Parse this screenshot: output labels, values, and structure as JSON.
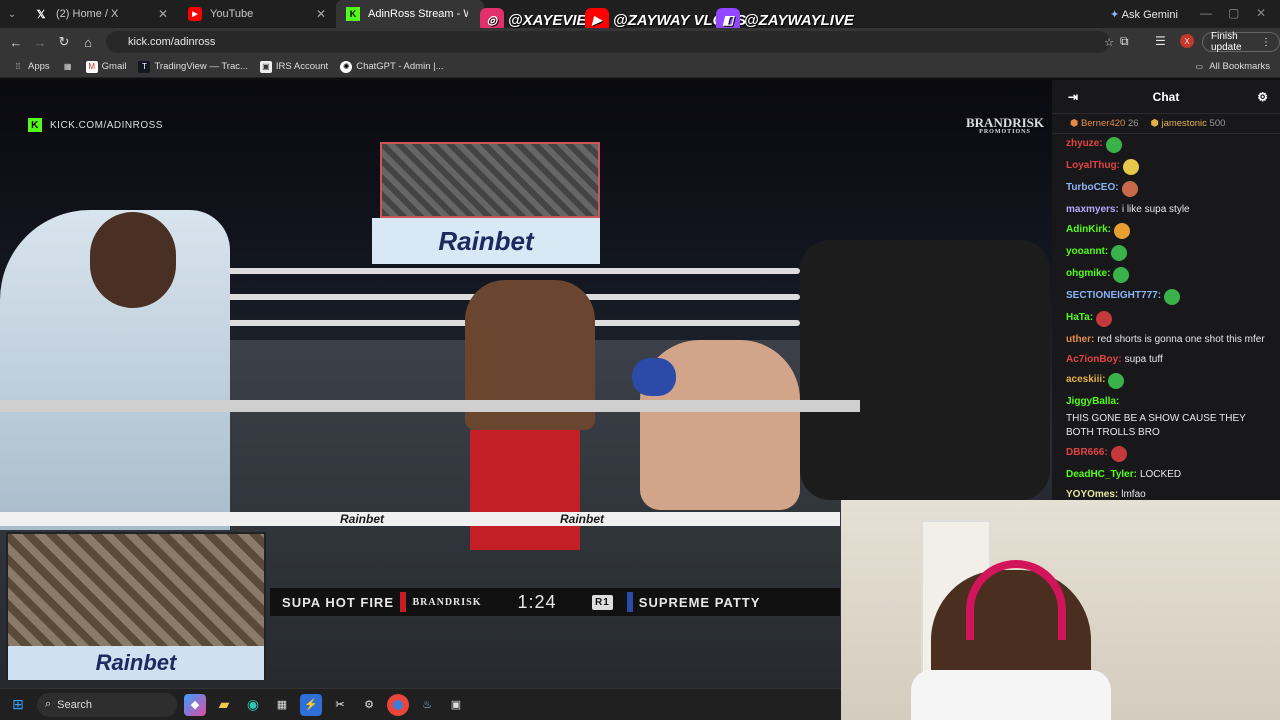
{
  "browser": {
    "tabs": [
      {
        "label": "(2) Home / X",
        "icon": "x-logo-icon"
      },
      {
        "label": "YouTube",
        "icon": "youtube-icon"
      },
      {
        "label": "AdinRoss Stream - Watch L",
        "icon": "kick-icon"
      }
    ],
    "ask_gemini": "Ask Gemini",
    "url": "kick.com/adinross",
    "finish_update": "Finish update",
    "profile_initial": "X",
    "bookmarks": [
      {
        "label": "Apps"
      },
      {
        "label": "Gmail"
      },
      {
        "label": "TradingView — Trac..."
      },
      {
        "label": "IRS Account"
      },
      {
        "label": "ChatGPT - Admin |..."
      }
    ],
    "all_bookmarks": "All Bookmarks"
  },
  "overlay": {
    "socials": [
      {
        "handle": "@XAYEVIER",
        "icon": "instagram-icon",
        "color": "#e1306c"
      },
      {
        "handle": "@ZAYWAY VLOGS",
        "icon": "youtube-icon",
        "color": "#ff0000"
      },
      {
        "handle": "@ZAYWAYLIVE",
        "icon": "twitch-icon",
        "color": "#9146ff"
      }
    ]
  },
  "stream": {
    "watermark": "KICK.COM/ADINROSS",
    "brand": "BRANDRISK",
    "brand_sub": "PROMOTIONS",
    "sponsor": "Rainbet",
    "scoreboard": {
      "fighter_left": "SUPA HOT FIRE",
      "promo": "BRANDRISK",
      "time": "1:24",
      "round": "R1",
      "fighter_right": "SUPREME PATTY"
    }
  },
  "chat": {
    "title": "Chat",
    "pinned": [
      {
        "user": "Berner420",
        "value": "26",
        "color": "#e58a4a"
      },
      {
        "user": "jamestonic",
        "value": "500",
        "color": "#e5b04a"
      }
    ],
    "messages": [
      {
        "user": "zhyuze:",
        "text": "",
        "color": "#e04444",
        "emote": "#3ab24a"
      },
      {
        "user": "LoyalThug:",
        "text": "",
        "color": "#e04444",
        "emote": "#e6c84a"
      },
      {
        "user": "TurboCEO:",
        "text": "",
        "color": "#8ab4f8",
        "emote": "#c76a4a"
      },
      {
        "user": "maxmyers:",
        "text": "i like supa style",
        "color": "#b6a6ff",
        "emote": ""
      },
      {
        "user": "AdinKirk:",
        "text": "",
        "color": "#53fc18",
        "emote": "#e6a030"
      },
      {
        "user": "yooannt:",
        "text": "",
        "color": "#53fc18",
        "emote": "#3ab24a"
      },
      {
        "user": "ohgmike:",
        "text": "",
        "color": "#53fc18",
        "emote": "#3ab24a"
      },
      {
        "user": "SECTIONEIGHT777:",
        "text": "",
        "color": "#8ab4f8",
        "emote": "#3ab24a"
      },
      {
        "user": "HaTa:",
        "text": "",
        "color": "#53fc18",
        "emote": "#c43a3a"
      },
      {
        "user": "uther:",
        "text": "red shorts is gonna one shot this mfer",
        "color": "#e58a4a",
        "emote": ""
      },
      {
        "user": "Ac7ionBoy:",
        "text": "supa tuff",
        "color": "#e04444",
        "emote": ""
      },
      {
        "user": "aceskiii:",
        "text": "",
        "color": "#e5b04a",
        "emote": "#3ab24a"
      },
      {
        "user": "JiggyBalla:",
        "text": "THIS GONE BE A SHOW CAUSE THEY BOTH TROLLS BRO",
        "color": "#53fc18",
        "emote": ""
      },
      {
        "user": "DBR666:",
        "text": "",
        "color": "#e04444",
        "emote": "#c43a3a"
      },
      {
        "user": "DeadHC_Tyler:",
        "text": "LOCKED",
        "color": "#53fc18",
        "emote": ""
      },
      {
        "user": "YOYOmes:",
        "text": "lmfao",
        "color": "#e5e5a0",
        "emote": ""
      }
    ]
  },
  "taskbar": {
    "search_placeholder": "Search"
  }
}
